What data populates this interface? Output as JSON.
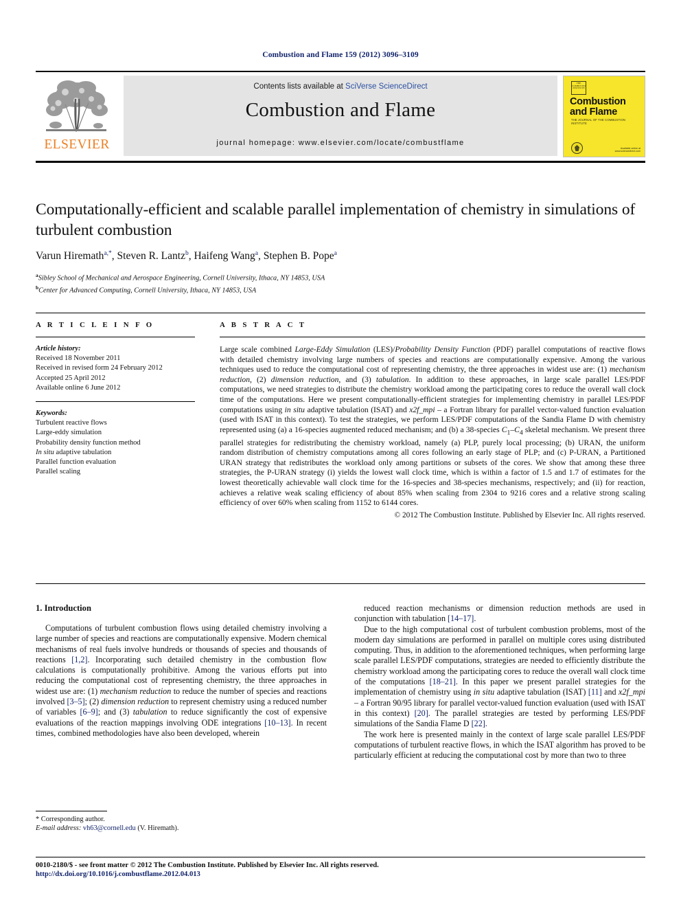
{
  "running_head": "Combustion and Flame 159 (2012) 3096–3109",
  "masthead": {
    "contents_prefix": "Contents lists available at ",
    "sciencedirect_link": "SciVerse ScienceDirect",
    "journal_title": "Combustion and Flame",
    "homepage": "journal homepage: www.elsevier.com/locate/combustflame",
    "publisher_logo_word": "ELSEVIER",
    "publisher_logo_icon": "elsevier-tree-icon",
    "cover": {
      "mini_logo_text": "THE COMBUSTION INSTITUTE",
      "title": "Combustion and Flame",
      "subtitle": "THE JOURNAL OF THE COMBUSTION INSTITUTE",
      "footer_text": "Available online at www.sciencedirect.com"
    }
  },
  "article": {
    "title": "Computationally-efficient and scalable parallel implementation of chemistry in simulations of turbulent combustion",
    "authors": [
      {
        "name": "Varun Hiremath",
        "marks": "a,*"
      },
      {
        "name": "Steven R. Lantz",
        "marks": "b"
      },
      {
        "name": "Haifeng Wang",
        "marks": "a"
      },
      {
        "name": "Stephen B. Pope",
        "marks": "a"
      }
    ],
    "affiliations": [
      {
        "mark": "a",
        "text": "Sibley School of Mechanical and Aerospace Engineering, Cornell University, Ithaca, NY 14853, USA"
      },
      {
        "mark": "b",
        "text": "Center for Advanced Computing, Cornell University, Ithaca, NY 14853, USA"
      }
    ]
  },
  "article_info": {
    "heading": "A R T I C L E  I N F O",
    "history_label": "Article history:",
    "history": [
      "Received 18 November 2011",
      "Received in revised form 24 February 2012",
      "Accepted 25 April 2012",
      "Available online 6 June 2012"
    ],
    "keywords_label": "Keywords:",
    "keywords": [
      "Turbulent reactive flows",
      "Large-eddy simulation",
      "Probability density function method",
      "In situ adaptive tabulation",
      "Parallel function evaluation",
      "Parallel scaling"
    ]
  },
  "abstract": {
    "heading": "A B S T R A C T",
    "text_html": "Large scale combined <em>Large-Eddy Simulation</em> (LES)/<em>Probability Density Function</em> (PDF) parallel computations of reactive flows with detailed chemistry involving large numbers of species and reactions are computationally expensive. Among the various techniques used to reduce the computational cost of representing chemistry, the three approaches in widest use are: (1) <em>mechanism reduction</em>, (2) <em>dimension reduction</em>, and (3) <em>tabulation</em>. In addition to these approaches, in large scale parallel LES/PDF computations, we need strategies to distribute the chemistry workload among the participating cores to reduce the overall wall clock time of the computations. Here we present computationally-efficient strategies for implementing chemistry in parallel LES/PDF computations using <em>in situ</em> adaptive tabulation (ISAT) and <em>x2f_mpi</em> – a Fortran library for parallel vector-valued function evaluation (used with ISAT in this context). To test the strategies, we perform LES/PDF computations of the Sandia Flame D with chemistry represented using (a) a 16-species augmented reduced mechanism; and (b) a 38-species <em>C</em><sub>1</sub>–<em>C</em><sub>4</sub> skeletal mechanism. We present three parallel strategies for redistributing the chemistry workload, namely (a) PLP, purely local processing; (b) URAN, the uniform random distribution of chemistry computations among all cores following an early stage of PLP; and (c) P-URAN, a Partitioned URAN strategy that redistributes the workload only among partitions or subsets of the cores. We show that among these three strategies, the P-URAN strategy (i) yields the lowest wall clock time, which is within a factor of 1.5 and 1.7 of estimates for the lowest theoretically achievable wall clock time for the 16-species and 38-species mechanisms, respectively; and (ii) for reaction, achieves a relative weak scaling efficiency of about 85% when scaling from 2304 to 9216 cores and a relative strong scaling efficiency of over 60% when scaling from 1152 to 6144 cores.",
    "copyright": "© 2012 The Combustion Institute. Published by Elsevier Inc. All rights reserved."
  },
  "body": {
    "section_heading": "1. Introduction",
    "left_paragraphs_html": [
      "Computations of turbulent combustion flows using detailed chemistry involving a large number of species and reactions are computationally expensive. Modern chemical mechanisms of real fuels involve hundreds or thousands of species and thousands of reactions <span class=\"cite\">[1,2]</span>. Incorporating such detailed chemistry in the combustion flow calculations is computationally prohibitive. Among the various efforts put into reducing the computational cost of representing chemistry, the three approaches in widest use are: (1) <em>mechanism reduction</em> to reduce the number of species and reactions involved <span class=\"cite\">[3–5]</span>; (2) <em>dimension reduction</em> to represent chemistry using a reduced number of variables <span class=\"cite\">[6–9]</span>; and (3) <em>tabulation</em> to reduce significantly the cost of expensive evaluations of the reaction mappings involving ODE integrations <span class=\"cite\">[10–13]</span>. In recent times, combined methodologies have also been developed, wherein"
    ],
    "right_paragraphs_html": [
      "reduced reaction mechanisms or dimension reduction methods are used in conjunction with tabulation <span class=\"cite\">[14–17]</span>.",
      "Due to the high computational cost of turbulent combustion problems, most of the modern day simulations are performed in parallel on multiple cores using distributed computing. Thus, in addition to the aforementioned techniques, when performing large scale parallel LES/PDF computations, strategies are needed to efficiently distribute the chemistry workload among the participating cores to reduce the overall wall clock time of the computations <span class=\"cite\">[18–21]</span>. In this paper we present parallel strategies for the implementation of chemistry using <em>in situ</em> adaptive tabulation (ISAT) <span class=\"cite\">[11]</span> and <em>x2f_mpi</em> – a Fortran 90/95 library for parallel vector-valued function evaluation (used with ISAT in this context) <span class=\"cite\">[20]</span>. The parallel strategies are tested by performing LES/PDF simulations of the Sandia Flame D <span class=\"cite\">[22]</span>.",
      "The work here is presented mainly in the context of large scale parallel LES/PDF computations of turbulent reactive flows, in which the ISAT algorithm has proved to be particularly efficient at reducing the computational cost by more than two to three"
    ]
  },
  "footnote": {
    "corresponding_author": "* Corresponding author.",
    "email_label": "E-mail address:",
    "email": "vh63@cornell.edu",
    "email_suffix": "(V. Hiremath)."
  },
  "page_footer": {
    "issn_line": "0010-2180/$ - see front matter © 2012 The Combustion Institute. Published by Elsevier Inc. All rights reserved.",
    "doi": "http://dx.doi.org/10.1016/j.combustflame.2012.04.013"
  },
  "colors": {
    "link_blue": "#12246b",
    "sciencedirect_blue": "#2a4fa2",
    "elsevier_orange": "#ec8024",
    "cover_yellow": "#f6e52a",
    "masthead_grey": "#e4e4e4"
  }
}
